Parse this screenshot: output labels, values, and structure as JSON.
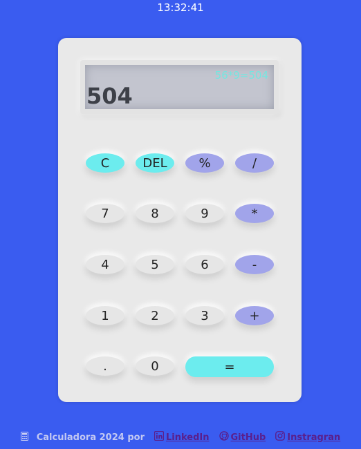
{
  "clock": "13:32:41",
  "display": {
    "expression": "56*9=504",
    "result": "504"
  },
  "keys": {
    "clear": "C",
    "delete": "DEL",
    "percent": "%",
    "divide": "/",
    "seven": "7",
    "eight": "8",
    "nine": "9",
    "multiply": "*",
    "four": "4",
    "five": "5",
    "six": "6",
    "minus": "-",
    "one": "1",
    "two": "2",
    "three": "3",
    "plus": "+",
    "dot": ".",
    "zero": "0",
    "equals": "="
  },
  "footer": {
    "icon": "calculator-icon",
    "credit": "Calculadora 2024 por",
    "links": [
      {
        "icon": "linkedin-icon",
        "label": "LinkedIn"
      },
      {
        "icon": "github-icon",
        "label": "GitHub"
      },
      {
        "icon": "instagram-icon",
        "label": "Instragran"
      }
    ]
  },
  "colors": {
    "background": "#3a5cf0",
    "body": "#e9e9e9",
    "accent_cyan": "#6cecee",
    "accent_purple": "#a1a4ea",
    "expression_text": "#74e6e0",
    "link": "#5a1f8c"
  }
}
